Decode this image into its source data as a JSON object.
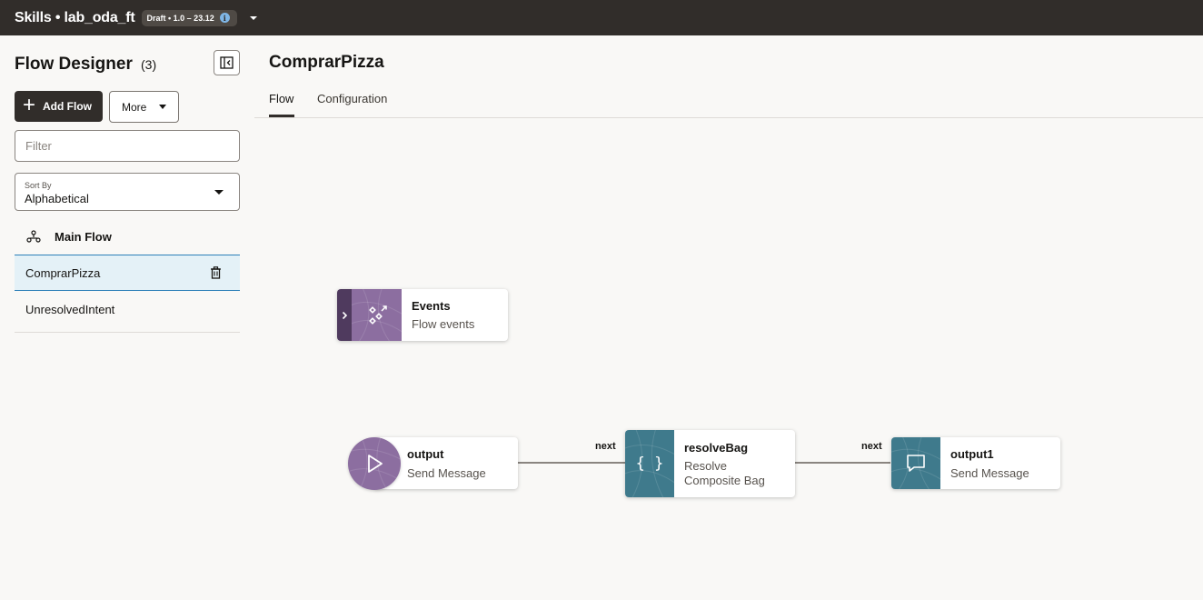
{
  "topbar": {
    "title": "Skills • lab_oda_ft",
    "badge": "Draft • 1.0 – 23.12",
    "info_icon": "i"
  },
  "left": {
    "title": "Flow Designer",
    "count": "(3)",
    "add_flow_label": "Add Flow",
    "more_label": "More",
    "filter_placeholder": "Filter",
    "sort_label": "Sort By",
    "sort_value": "Alphabetical",
    "main_flow_label": "Main Flow",
    "flows": [
      {
        "label": "ComprarPizza",
        "selected": true
      },
      {
        "label": "UnresolvedIntent",
        "selected": false
      }
    ]
  },
  "main": {
    "title": "ComprarPizza",
    "tabs": [
      {
        "label": "Flow",
        "active": true
      },
      {
        "label": "Configuration",
        "active": false
      }
    ]
  },
  "canvas": {
    "events_node": {
      "name": "Events",
      "type": "Flow events",
      "icon": "events-icon"
    },
    "nodes": [
      {
        "name": "output",
        "type": "Send Message",
        "icon": "play-icon"
      },
      {
        "name": "resolveBag",
        "type": "Resolve Composite Bag",
        "icon": "braces-icon"
      },
      {
        "name": "output1",
        "type": "Send Message",
        "icon": "chat-bubble-icon"
      }
    ],
    "transitions": [
      "next",
      "next"
    ]
  },
  "colors": {
    "topbar": "#312d2a",
    "events_purple": "#8c6ea0",
    "events_dark": "#4f3a5e",
    "teal": "#3f7a8c",
    "selected_bg": "#e4f1f7",
    "selected_border": "#2c7fb8"
  }
}
